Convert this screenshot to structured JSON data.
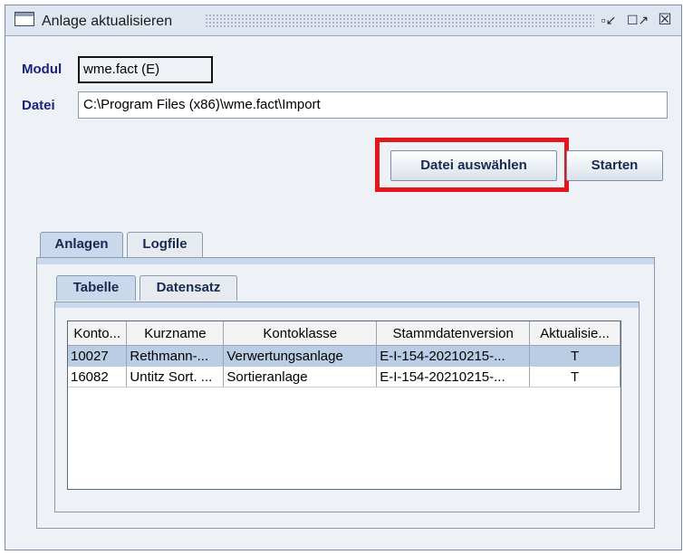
{
  "window": {
    "title": "Anlage aktualisieren"
  },
  "form": {
    "modul_label": "Modul",
    "modul_value": "wme.fact (E)",
    "datei_label": "Datei",
    "datei_value": "C:\\Program Files (x86)\\wme.fact\\Import"
  },
  "buttons": {
    "select_file": "Datei auswählen",
    "start": "Starten"
  },
  "tabs": {
    "outer": [
      {
        "label": "Anlagen",
        "selected": true
      },
      {
        "label": "Logfile",
        "selected": false
      }
    ],
    "inner": [
      {
        "label": "Tabelle",
        "selected": true
      },
      {
        "label": "Datensatz",
        "selected": false
      }
    ]
  },
  "table": {
    "columns": [
      "Konto...",
      "Kurzname",
      "Kontoklasse",
      "Stammdatenversion",
      "Aktualisie..."
    ],
    "rows": [
      {
        "cells": [
          "10027",
          "Rethmann-...",
          "Verwertungsanlage",
          "E-I-154-20210215-...",
          "T"
        ],
        "selected": true
      },
      {
        "cells": [
          "16082",
          "Untitz Sort. ...",
          "Sortieranlage",
          "E-I-154-20210215-...",
          "T"
        ],
        "selected": false
      }
    ]
  },
  "colors": {
    "highlight": "#e3161c",
    "label_blue": "#1a237e",
    "selection": "#b9cde5"
  },
  "icons": {
    "window": "window-icon",
    "restore": "restore-icon",
    "maximize": "maximize-icon",
    "close": "close-icon"
  }
}
